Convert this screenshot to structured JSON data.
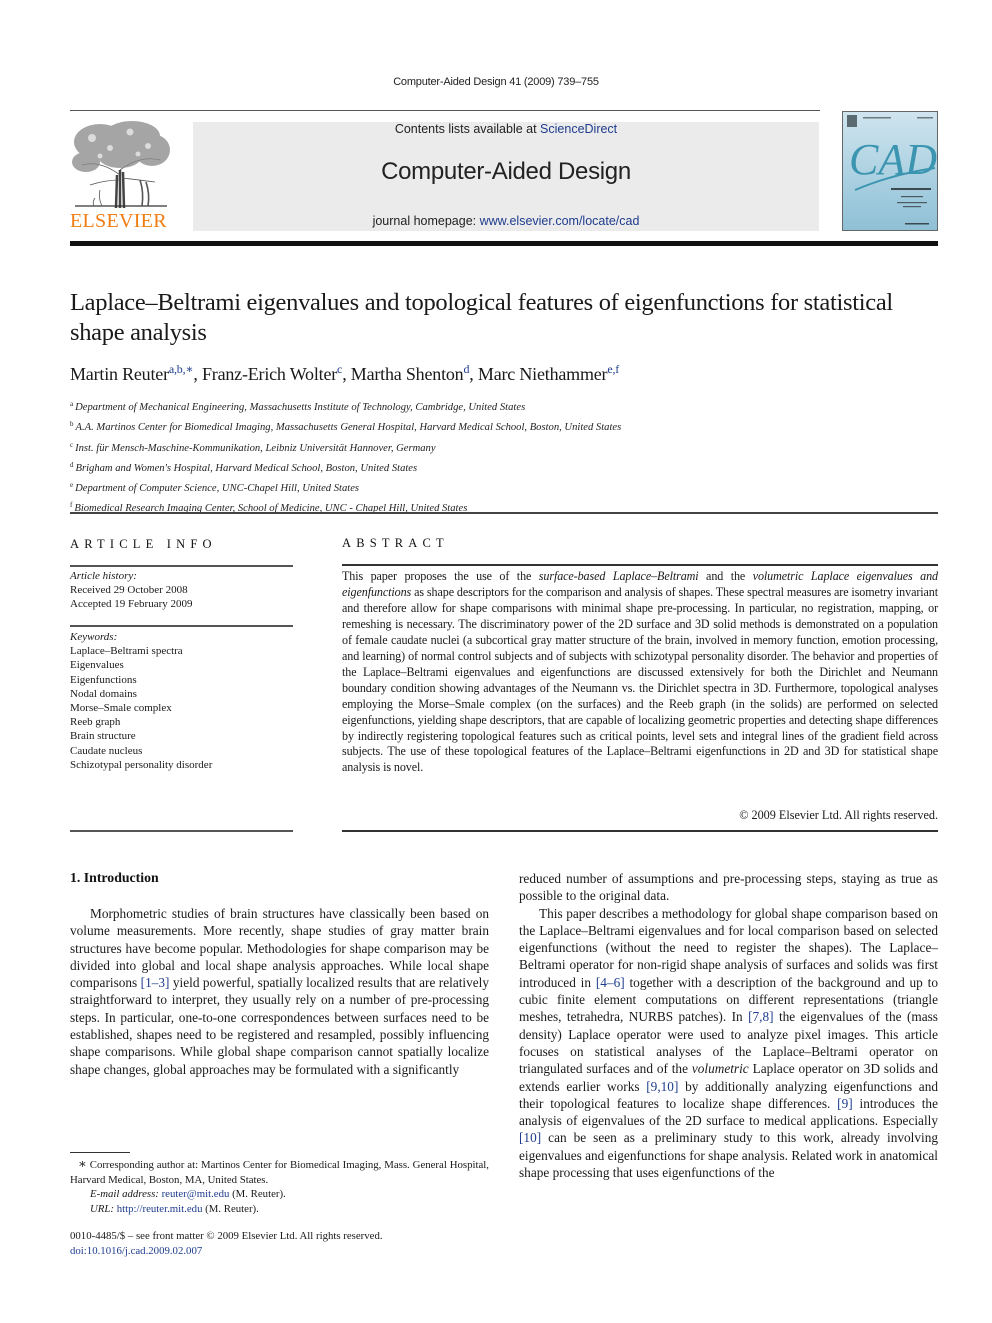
{
  "running_head": "Computer-Aided Design 41 (2009) 739–755",
  "masthead": {
    "publisher": "ELSEVIER",
    "contents_prefix": "Contents lists available at ",
    "contents_link": "ScienceDirect",
    "journal_name": "Computer-Aided Design",
    "homepage_prefix": "journal homepage: ",
    "homepage_link": "www.elsevier.com/locate/cad",
    "cover_title": "CAD",
    "colors": {
      "publisher_orange": "#f07c12",
      "link_blue": "#1f3c8e",
      "masthead_bg": "#ebebeb",
      "cover_teal": "#3c95b0"
    }
  },
  "article": {
    "title": "Laplace–Beltrami eigenvalues and topological features of eigenfunctions for statistical shape analysis",
    "authors": [
      {
        "name": "Martin Reuter",
        "sup": "a,b,∗",
        "sep": ", "
      },
      {
        "name": "Franz-Erich Wolter",
        "sup": "c",
        "sep": ", "
      },
      {
        "name": "Martha Shenton",
        "sup": "d",
        "sep": ", "
      },
      {
        "name": "Marc Niethammer",
        "sup": "e,f",
        "sep": ""
      }
    ],
    "affiliations": [
      {
        "key": "a",
        "text": "Department of Mechanical Engineering, Massachusetts Institute of Technology, Cambridge, United States"
      },
      {
        "key": "b",
        "text": "A.A. Martinos Center for Biomedical Imaging, Massachusetts General Hospital, Harvard Medical School, Boston, United States"
      },
      {
        "key": "c",
        "text": "Inst. für Mensch-Maschine-Kommunikation, Leibniz Universität Hannover, Germany"
      },
      {
        "key": "d",
        "text": "Brigham and Women's Hospital, Harvard Medical School, Boston, United States"
      },
      {
        "key": "e",
        "text": "Department of Computer Science, UNC-Chapel Hill, United States"
      },
      {
        "key": "f",
        "text": "Biomedical Research Imaging Center, School of Medicine, UNC - Chapel Hill, United States"
      }
    ]
  },
  "article_info": {
    "heading": "ARTICLE INFO",
    "history_label": "Article history:",
    "received": "Received 29 October 2008",
    "accepted": "Accepted 19 February 2009",
    "keywords_label": "Keywords:",
    "keywords": [
      "Laplace–Beltrami spectra",
      "Eigenvalues",
      "Eigenfunctions",
      "Nodal domains",
      "Morse–Smale complex",
      "Reeb graph",
      "Brain structure",
      "Caudate nucleus",
      "Schizotypal personality disorder"
    ]
  },
  "abstract": {
    "heading": "ABSTRACT",
    "part1": "This paper proposes the use of the ",
    "it1": "surface-based Laplace–Beltrami",
    "part2": " and the ",
    "it2": "volumetric Laplace eigenvalues and eigenfunctions",
    "part3": " as shape descriptors for the comparison and analysis of shapes. These spectral measures are isometry invariant and therefore allow for shape comparisons with minimal shape pre-processing. In particular, no registration, mapping, or remeshing is necessary. The discriminatory power of the 2D surface and 3D solid methods is demonstrated on a population of female caudate nuclei (a subcortical gray matter structure of the brain, involved in memory function, emotion processing, and learning) of normal control subjects and of subjects with schizotypal personality disorder. The behavior and properties of the Laplace–Beltrami eigenvalues and eigenfunctions are discussed extensively for both the Dirichlet and Neumann boundary condition showing advantages of the Neumann vs. the Dirichlet spectra in 3D. Furthermore, topological analyses employing the Morse–Smale complex (on the surfaces) and the Reeb graph (in the solids) are performed on selected eigenfunctions, yielding shape descriptors, that are capable of localizing geometric properties and detecting shape differences by indirectly registering topological features such as critical points, level sets and integral lines of the gradient field across subjects. The use of these topological features of the Laplace–Beltrami eigenfunctions in 2D and 3D for statistical shape analysis is novel.",
    "copyright": "© 2009 Elsevier Ltd. All rights reserved."
  },
  "introduction": {
    "heading": "1.  Introduction",
    "left_p1_a": "Morphometric studies of brain structures have classically been based on volume measurements. More recently, shape studies of gray matter brain structures have become popular. Methodologies for shape comparison may be divided into global and local shape analysis approaches. While local shape comparisons ",
    "ref_1_3": "[1–3]",
    "left_p1_b": " yield powerful, spatially localized results that are relatively straightforward to interpret, they usually rely on a number of pre-processing steps. In particular, one-to-one correspondences between surfaces need to be established, shapes need to be registered and resampled, possibly influencing shape comparisons. While global shape comparison cannot spatially localize shape changes, global approaches may be formulated with a significantly",
    "right_p1": "reduced number of assumptions and pre-processing steps, staying as true as possible to the original data.",
    "right_p2_a": "This paper describes a methodology for global shape comparison based on the Laplace–Beltrami eigenvalues and for local comparison based on selected eigenfunctions (without the need to register the shapes). The Laplace–Beltrami operator for non-rigid shape analysis of surfaces and solids was first introduced in ",
    "ref_4_6": "[4–6]",
    "right_p2_b": " together with a description of the background and up to cubic finite element computations on different representations (triangle meshes, tetrahedra, NURBS patches). In ",
    "ref_7_8": "[7,8]",
    "right_p2_c": " the eigenvalues of the (mass density) Laplace operator were used to analyze pixel images. This article focuses on statistical analyses of the Laplace–Beltrami operator on triangulated surfaces and of the ",
    "right_p2_it": "volumetric",
    "right_p2_d": " Laplace operator on 3D solids and extends earlier works ",
    "ref_9_10": "[9,10]",
    "right_p2_e": " by additionally analyzing eigenfunctions and their topological features to localize shape differences. ",
    "ref_9": "[9]",
    "right_p2_f": " introduces the analysis of eigenvalues of the 2D surface to medical applications. Especially ",
    "ref_10": "[10]",
    "right_p2_g": " can be seen as a preliminary study to this work, already involving eigenvalues and eigenfunctions for shape analysis. Related work in anatomical shape processing that uses eigenfunctions of the"
  },
  "footnotes": {
    "star": "∗",
    "corresponding": " Corresponding author at: Martinos Center for Biomedical Imaging, Mass. General Hospital, Harvard Medical, Boston, MA, United States.",
    "email_label": "E-mail address:",
    "email": "reuter@mit.edu",
    "email_suffix": " (M. Reuter).",
    "url_label": "URL:",
    "url": "http://reuter.mit.edu",
    "url_suffix": " (M. Reuter)."
  },
  "front_matter": {
    "issn_line": "0010-4485/$ – see front matter © 2009 Elsevier Ltd. All rights reserved.",
    "doi": "doi:10.1016/j.cad.2009.02.007"
  }
}
